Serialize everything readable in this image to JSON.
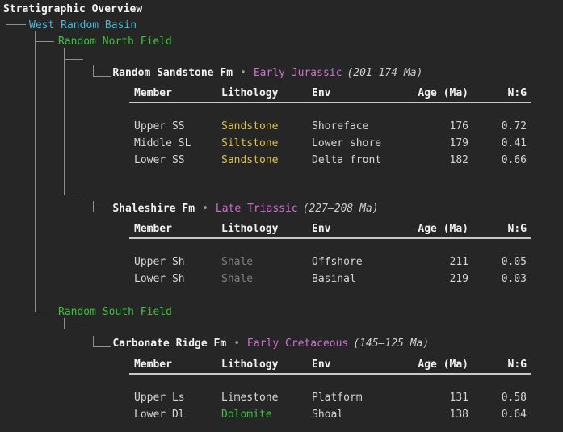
{
  "title": "Stratigraphic Overview",
  "tree": {
    "basin": "West Random Basin",
    "fields": [
      "Random North Field",
      "Random South Field"
    ]
  },
  "formations": [
    {
      "name": "Random Sandstone Fm",
      "bullet": "•",
      "epoch": "Early Jurassic",
      "age_range": "(201–174 Ma)",
      "table": {
        "headers": [
          "Member",
          "Lithology",
          "Env",
          "Age (Ma)",
          "N:G"
        ],
        "rows": [
          {
            "member": "Upper SS",
            "lithology": "Sandstone",
            "env": "Shoreface",
            "age": "176",
            "ng": "0.72"
          },
          {
            "member": "Middle SL",
            "lithology": "Siltstone",
            "env": "Lower shore",
            "age": "179",
            "ng": "0.41"
          },
          {
            "member": "Lower SS",
            "lithology": "Sandstone",
            "env": "Delta front",
            "age": "182",
            "ng": "0.66"
          }
        ]
      }
    },
    {
      "name": "Shaleshire Fm",
      "bullet": "•",
      "epoch": "Late Triassic",
      "age_range": "(227–208 Ma)",
      "table": {
        "headers": [
          "Member",
          "Lithology",
          "Env",
          "Age (Ma)",
          "N:G"
        ],
        "rows": [
          {
            "member": "Upper Sh",
            "lithology": "Shale",
            "env": "Offshore",
            "age": "211",
            "ng": "0.05"
          },
          {
            "member": "Lower Sh",
            "lithology": "Shale",
            "env": "Basinal",
            "age": "219",
            "ng": "0.03"
          }
        ]
      }
    },
    {
      "name": "Carbonate Ridge Fm",
      "bullet": "•",
      "epoch": "Early Cretaceous",
      "age_range": "(145–125 Ma)",
      "table": {
        "headers": [
          "Member",
          "Lithology",
          "Env",
          "Age (Ma)",
          "N:G"
        ],
        "rows": [
          {
            "member": "Upper Ls",
            "lithology": "Limestone",
            "env": "Platform",
            "age": "131",
            "ng": "0.58"
          },
          {
            "member": "Lower Dl",
            "lithology": "Dolomite",
            "env": "Shoal",
            "age": "138",
            "ng": "0.64"
          }
        ]
      }
    }
  ],
  "colors": {
    "background": "#262626",
    "default_text": "#d6d6d6",
    "bold_white": "#f2f2f2",
    "basin_cyan": "#4db9d9",
    "field_green": "#3dc23d",
    "epoch_magenta": "#d26fd2",
    "sandstone_yellow": "#ddc24a",
    "shale_gray": "#808080",
    "dolomite_green": "#3dc23d",
    "tree_line_gray": "#8f8f8f",
    "header_rule": "#c9c9c9"
  }
}
